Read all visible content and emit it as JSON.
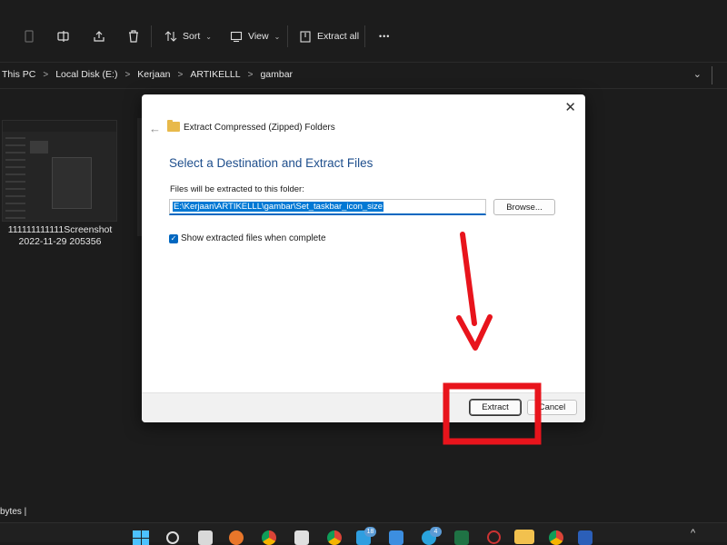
{
  "toolbar": {
    "sort_label": "Sort",
    "view_label": "View",
    "extract_all_label": "Extract all",
    "more_label": "•••"
  },
  "address": {
    "crumbs": [
      "This PC",
      "Local Disk (E:)",
      "Kerjaan",
      "ARTIKELLL",
      "gambar"
    ],
    "separator": ">"
  },
  "files": [
    {
      "name_line1": "111111111111Screenshot",
      "name_line2": "2022-11-29 205356"
    }
  ],
  "status": {
    "text": "bytes  |"
  },
  "dialog": {
    "window_title": "Extract Compressed (Zipped) Folders",
    "heading": "Select a Destination and Extract Files",
    "folder_label": "Files will be extracted to this folder:",
    "path_value": "E:\\Kerjaan\\ARTIKELLL\\gambar\\Set_taskbar_icon_size",
    "browse_label": "Browse...",
    "show_files_label": "Show extracted files when complete",
    "show_files_checked": true,
    "extract_label": "Extract",
    "cancel_label": "Cancel",
    "close_glyph": "✕",
    "back_glyph": "←"
  },
  "taskbar": {
    "mail_badge": "18",
    "telegram_badge": "4"
  },
  "colors": {
    "accent": "#0067c0",
    "annotation_red": "#e8141c",
    "heading_blue": "#1e4e8c"
  },
  "icons": [
    "delete-icon",
    "rename-icon",
    "share-icon",
    "trash-icon",
    "sort-icon",
    "view-icon",
    "extract-icon",
    "more-icon",
    "zip-folder-icon",
    "windows-start-icon",
    "search-icon"
  ]
}
